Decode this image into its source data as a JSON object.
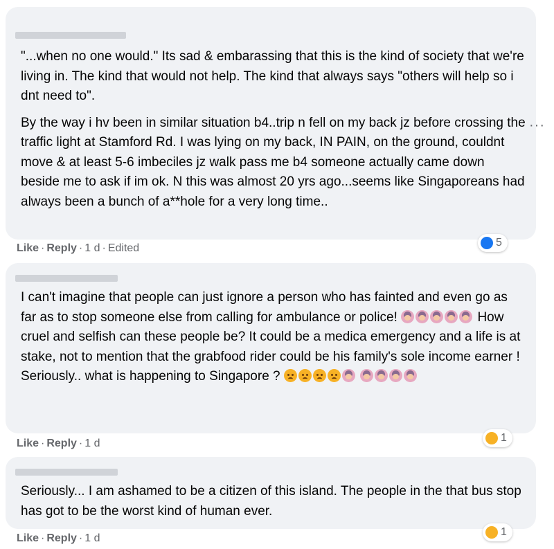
{
  "comments": [
    {
      "paragraphs": [
        "\"...when no one would.\" Its sad & embarassing that this is the kind of society that we're living in. The kind that would not help. The kind that always says \"others will help so i dnt need to\".",
        "By the way i hv been in similar situation b4..trip n fell on my back jz before crossing the traffic light at Stamford Rd. I was lying on my back, IN PAIN, on the ground, couldnt move & at least 5-6 imbeciles jz walk pass me b4 someone actually came down beside me to ask if im ok. N this was almost 20 yrs ago...seems like Singaporeans had always been a bunch of a**hole for a very long time.."
      ],
      "like_label": "Like",
      "reply_label": "Reply",
      "time": "1 d",
      "edited": "Edited",
      "reaction_icon": "like-reaction-icon",
      "reaction_count": "5"
    },
    {
      "text_part1": "I can't imagine that people can just ignore a person who has fainted and even go as far as to stop someone else from calling for ambulance or police!",
      "text_part2": "How cruel and selfish can these people be? It could be a medica emergency and a life is at stake, not to mention that the grabfood rider could be his family's sole income earner ! Seriously.. what is happening to Singapore ?",
      "like_label": "Like",
      "reply_label": "Reply",
      "time": "1 d",
      "reaction_icon": "sad-reaction-icon",
      "reaction_count": "1"
    },
    {
      "text": "Seriously... I am ashamed to be a citizen of this island. The people in the that bus stop has got to be the worst kind of human ever.",
      "like_label": "Like",
      "reply_label": "Reply",
      "time": "1 d",
      "reaction_icon": "sad-reaction-icon",
      "reaction_count": "1"
    }
  ],
  "more_label": "···",
  "colors": {
    "bubble": "#f0f2f5",
    "meta": "#65676b",
    "like_blue": "#1877f2",
    "sad_yellow": "#f7b125"
  }
}
